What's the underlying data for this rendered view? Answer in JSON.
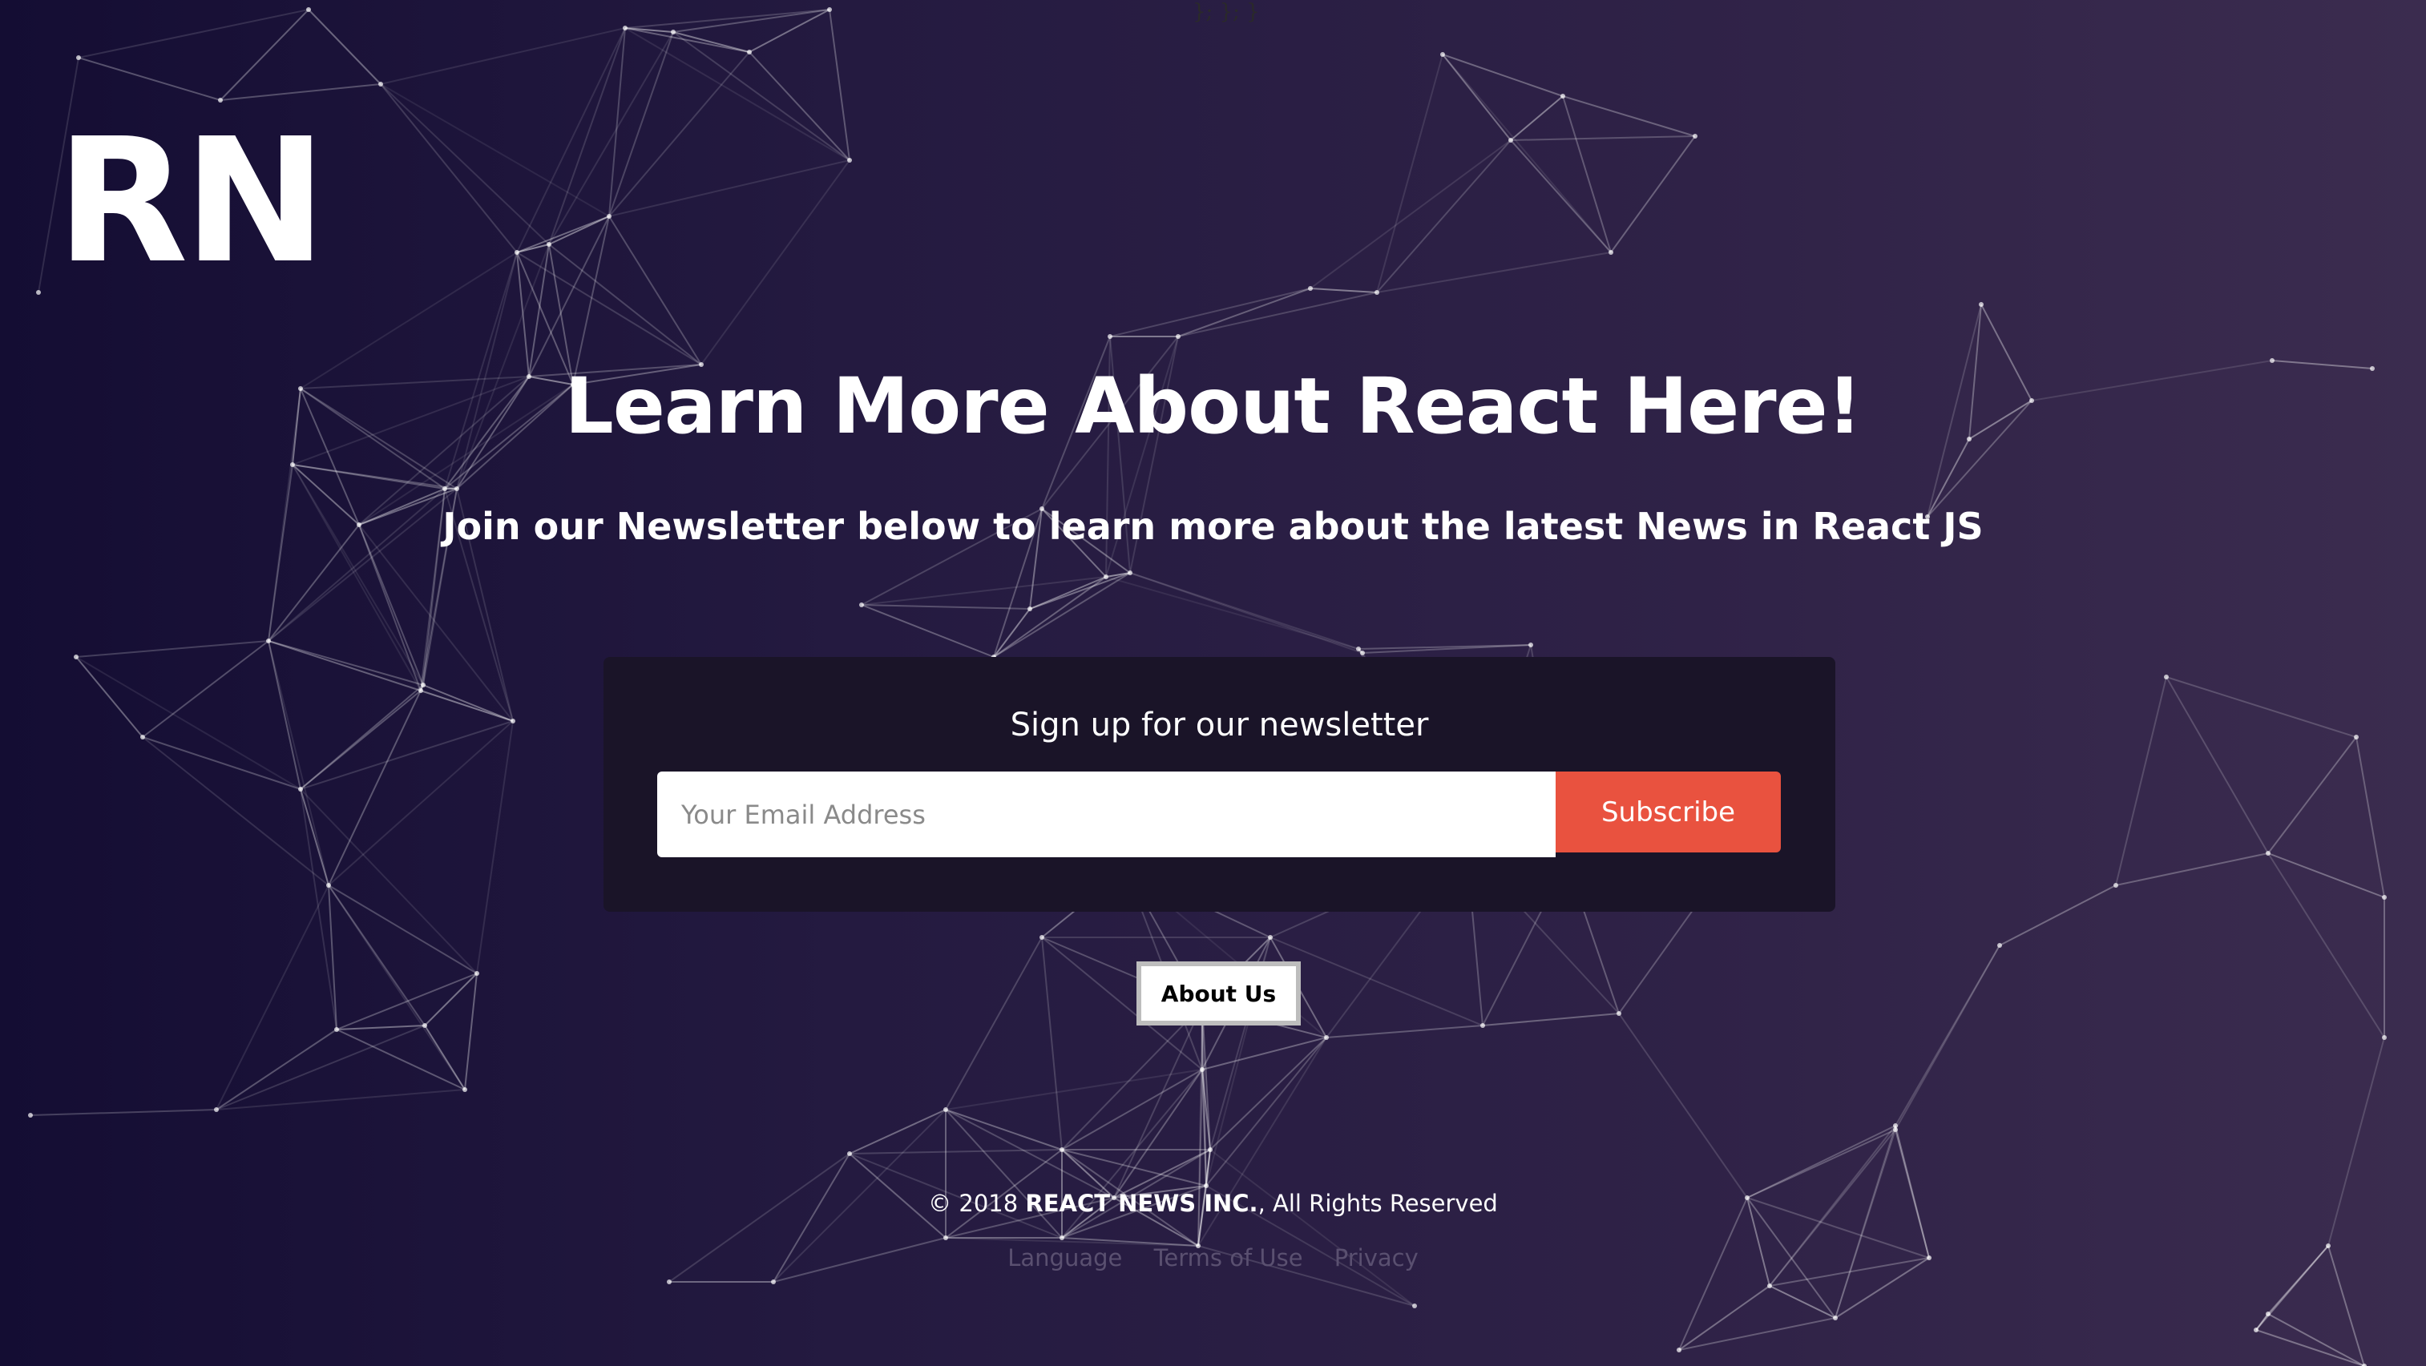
{
  "stray_text": "}; }; }",
  "logo": {
    "text": "RN"
  },
  "hero": {
    "headline": "Learn More About React Here!",
    "subheadline": "Join our Newsletter below to learn more about the latest News in React JS"
  },
  "newsletter": {
    "title": "Sign up for our newsletter",
    "email_placeholder": "Your Email Address",
    "email_value": "",
    "subscribe_label": "Subscribe"
  },
  "about_button_label": "About Us",
  "footer": {
    "copyright_prefix": "© 2018 ",
    "company": "REACT NEWS INC.",
    "copyright_suffix": ", All Rights Reserved",
    "links": [
      "Language",
      "Terms of Use",
      "Privacy"
    ]
  },
  "colors": {
    "background_left": "#140d33",
    "background_right": "#3b2c4f",
    "signup_box": "#1a1428",
    "subscribe_button": "#e9523f",
    "network_lines": "#ffffff",
    "footer_links": "#5a5070"
  }
}
